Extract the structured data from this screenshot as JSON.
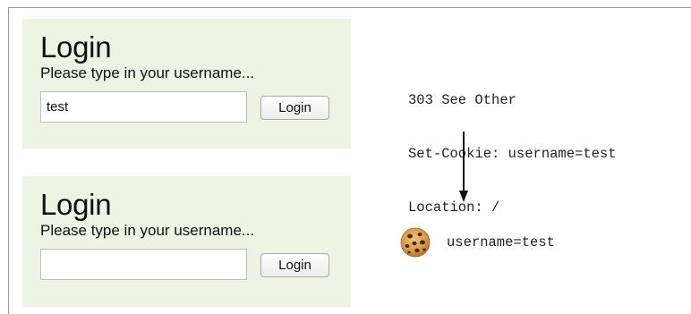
{
  "login_top": {
    "title": "Login",
    "prompt": "Please type in your username...",
    "input_value": "test",
    "button_label": "Login"
  },
  "login_bottom": {
    "title": "Login",
    "prompt": "Please type in your username...",
    "input_value": "",
    "button_label": "Login"
  },
  "http_response": {
    "status_line": "303 See Other",
    "set_cookie_line": "Set-Cookie: username=test",
    "location_line": "Location: /"
  },
  "cookie": {
    "icon": "cookie-icon",
    "text": "username=test"
  }
}
